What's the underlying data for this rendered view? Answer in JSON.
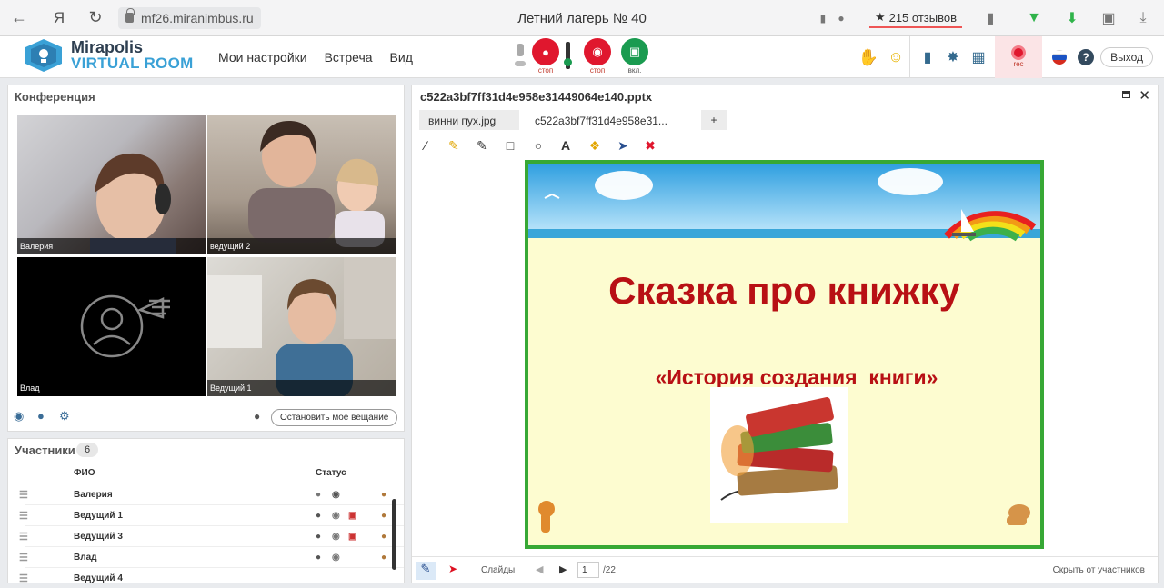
{
  "browser": {
    "url": "mf26.miranimbus.ru",
    "title": "Летний лагерь № 40",
    "reviews": "215 отзывов",
    "yandex_glyph": "Я"
  },
  "header": {
    "logo_line1": "Mirapolis",
    "logo_line2": "VIRTUAL ROOM",
    "menu": [
      "Мои настройки",
      "Встреча",
      "Вид"
    ],
    "mic_label": "стоп",
    "cam_label": "стоп",
    "screen_label": "вкл.",
    "rec_label": "rec",
    "exit_label": "Выход"
  },
  "conference": {
    "title": "Конференция",
    "videos": [
      "Валерия",
      "ведущий 2",
      "Влад",
      "Ведущий 1"
    ],
    "stop_broadcast": "Остановить мое вещание"
  },
  "participants": {
    "title": "Участники",
    "count": "6",
    "col_name": "ФИО",
    "col_status": "Статус",
    "rows": [
      "Валерия",
      "Ведущий 1",
      "Ведущий 3",
      "Влад",
      "Ведущий 4"
    ]
  },
  "document": {
    "filename": "c522a3bf7ff31d4e958e31449064e140.pptx",
    "tabs": [
      "винни пух.jpg",
      "c522a3bf7ff31d4e958e31..."
    ],
    "add_tab": "+",
    "slide_title": "Сказка про книжку",
    "slide_subtitle": "«История создания  книги»",
    "slides_label": "Слайды",
    "page": "1",
    "total": "/22",
    "hide_label": "Скрыть от участников"
  },
  "colors": {
    "accent": "#3aa1d6",
    "red": "#e0172e",
    "green_btn": "#1a9b50",
    "slide_title": "#b81014"
  }
}
